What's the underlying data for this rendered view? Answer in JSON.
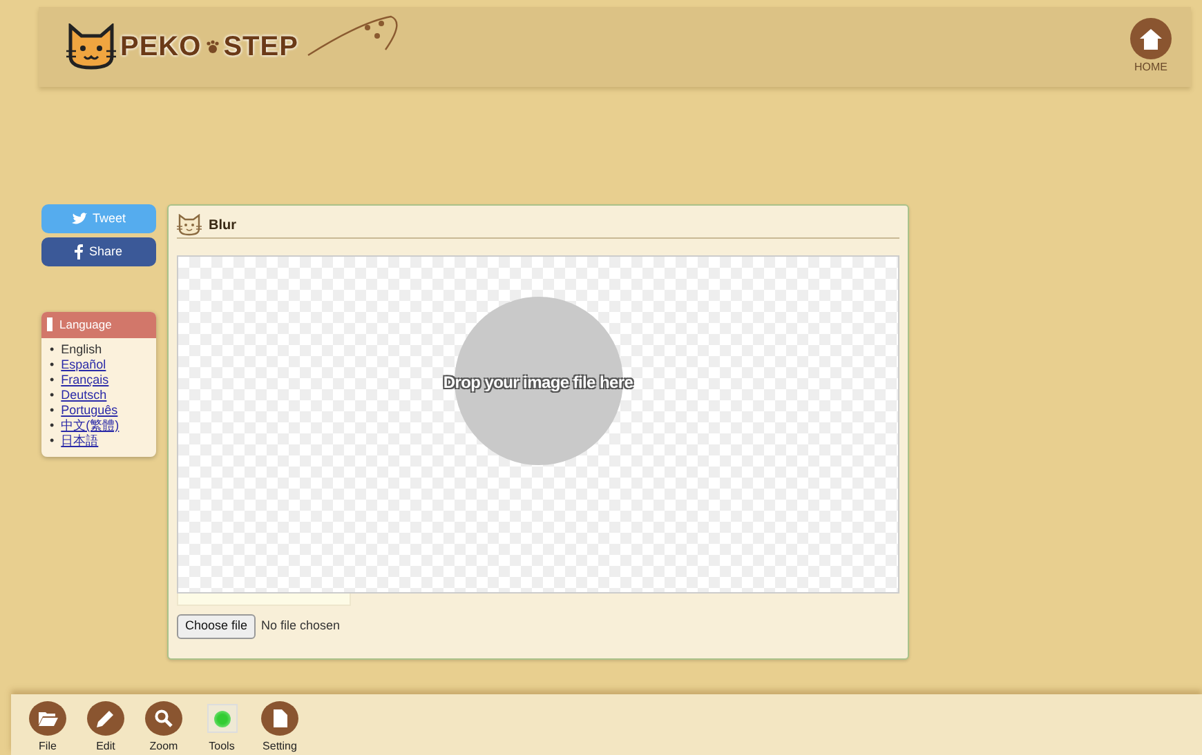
{
  "header": {
    "logo_text": "PEKO",
    "logo_text_2": "STEP",
    "home_label": "HOME"
  },
  "share_buttons": [
    {
      "kind": "twitter",
      "label": "Tweet"
    },
    {
      "kind": "facebook",
      "label": "Share"
    }
  ],
  "language": {
    "title": "Language",
    "items": [
      {
        "marker": "•",
        "label": "English",
        "selected": true
      },
      {
        "marker": "•",
        "label": "Español",
        "selected": false
      },
      {
        "marker": "•",
        "label": "Français",
        "selected": false
      },
      {
        "marker": "•",
        "label": "Deutsch",
        "selected": false
      },
      {
        "marker": "•",
        "label": "Português",
        "selected": false
      },
      {
        "marker": "•",
        "label": "中文(繁體)",
        "selected": false
      },
      {
        "marker": "•",
        "label": "日本語",
        "selected": false
      }
    ]
  },
  "panel": {
    "title": "Blur",
    "drop_text": "Drop your image file here",
    "file_button": "Choose file",
    "file_status": "No file chosen"
  },
  "toolbar": [
    {
      "kind": "folder",
      "label": "File"
    },
    {
      "kind": "pencil",
      "label": "Edit"
    },
    {
      "kind": "search",
      "label": "Zoom"
    },
    {
      "kind": "tools",
      "label": "Tools"
    },
    {
      "kind": "page",
      "label": "Setting"
    }
  ]
}
